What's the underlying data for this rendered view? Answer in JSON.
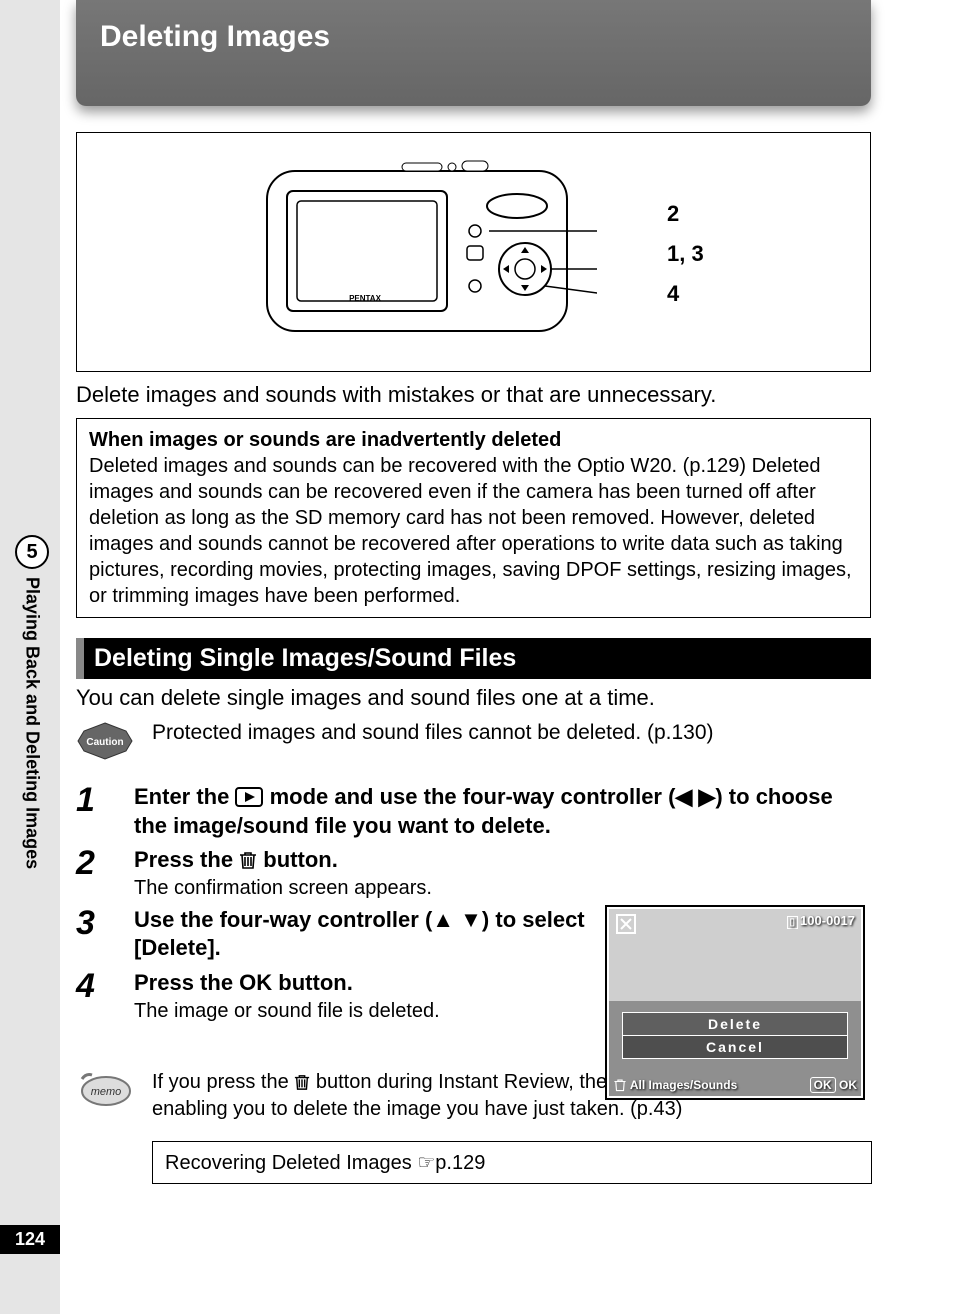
{
  "page_number": "124",
  "side_tab": {
    "chapter_num": "5",
    "label": "Playing Back and Deleting Images"
  },
  "chapter_title": "Deleting Images",
  "camera_callouts": {
    "a": "2",
    "b": "1, 3",
    "c": "4"
  },
  "camera_brand": "PENTAX",
  "intro": "Delete images and sounds with mistakes or that are unnecessary.",
  "info_box": {
    "title": "When images or sounds are inadvertently deleted",
    "body": "Deleted images and sounds can be recovered with the Optio W20. (p.129) Deleted images and sounds can be recovered even if the camera has been turned off after deletion as long as the SD memory card has not been removed. However, deleted images and sounds cannot be recovered after operations to write data such as taking pictures, recording movies, protecting images, saving DPOF settings, resizing images, or trimming images have been performed."
  },
  "section_title": "Deleting Single Images/Sound Files",
  "section_intro": "You can delete single images and sound files one at a time.",
  "caution_text": "Protected images and sound files cannot be deleted. (p.130)",
  "steps": [
    {
      "num": "1",
      "head_pre": "Enter the ",
      "head_post": " mode and use the four-way controller (◀ ▶) to choose the image/sound file you want to delete."
    },
    {
      "num": "2",
      "head_pre": "Press the ",
      "head_post": " button.",
      "sub": "The confirmation screen appears."
    },
    {
      "num": "3",
      "head": "Use the four-way controller (▲ ▼) to select [Delete]."
    },
    {
      "num": "4",
      "head_pre": "Press the ",
      "head_mid": "OK",
      "head_post": " button.",
      "sub": "The image or sound file is deleted."
    }
  ],
  "screen": {
    "file_id": "100-0017",
    "menu_delete": "Delete",
    "menu_cancel": "Cancel",
    "bottom_left": "All Images/Sounds",
    "bottom_right_label": "OK",
    "bottom_right_text": "OK"
  },
  "memo_text_pre": "If you press the ",
  "memo_text_post": " button during Instant Review, the screen in Step 2 appears, enabling you to delete the image you have just taken. (p.43)",
  "link_box": "Recovering Deleted Images ☞p.129"
}
